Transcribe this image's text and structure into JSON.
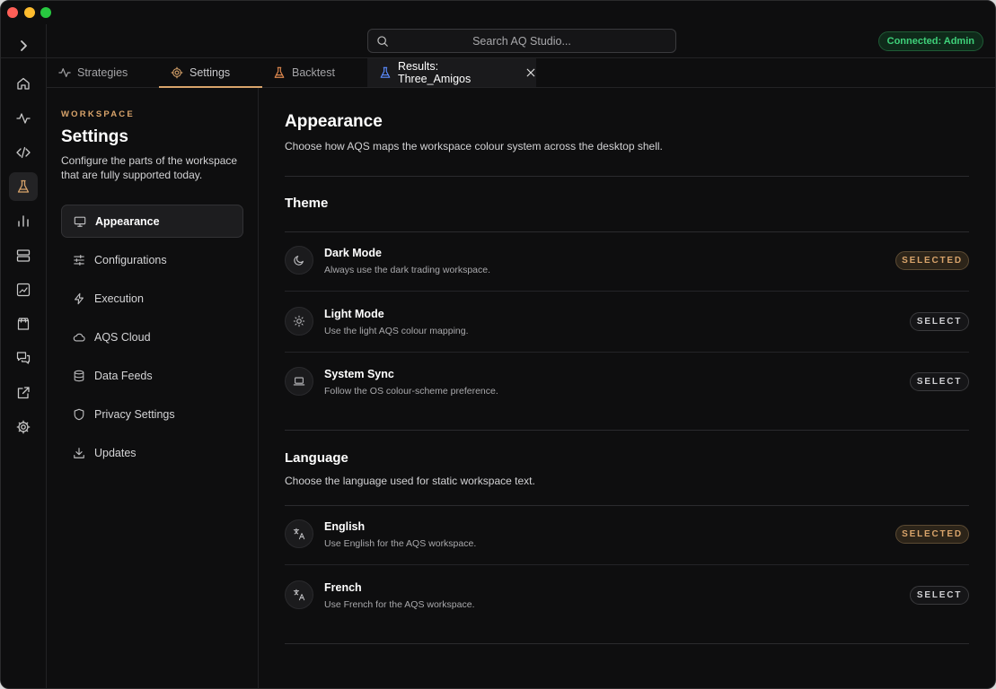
{
  "rail": {
    "toggle": "chevron-right-icon",
    "items": [
      "home-icon",
      "activity-icon",
      "code-icon",
      "flask-icon",
      "bar-chart-icon",
      "server-icon",
      "line-chart-icon",
      "shopping-bag-icon",
      "messages-icon",
      "external-link-icon",
      "gear-icon"
    ],
    "active_index": 3
  },
  "topbar": {
    "search_placeholder": "Search AQ Studio...",
    "connection_status": "Connected: Admin"
  },
  "tabs": [
    {
      "label": "Strategies",
      "icon": "activity-icon"
    },
    {
      "label": "Settings",
      "icon": "gear-icon",
      "active": true
    },
    {
      "label": "Backtest",
      "icon": "flask-icon"
    },
    {
      "label": "Results: Three_Amigos",
      "icon": "flask-icon",
      "closable": true
    }
  ],
  "sidebar": {
    "eyebrow": "WORKSPACE",
    "title": "Settings",
    "description": "Configure the parts of the workspace that are fully supported today.",
    "items": [
      {
        "label": "Appearance",
        "icon": "monitor-icon",
        "active": true
      },
      {
        "label": "Configurations",
        "icon": "sliders-icon"
      },
      {
        "label": "Execution",
        "icon": "bolt-icon"
      },
      {
        "label": "AQS Cloud",
        "icon": "cloud-icon"
      },
      {
        "label": "Data Feeds",
        "icon": "database-icon"
      },
      {
        "label": "Privacy Settings",
        "icon": "shield-icon"
      },
      {
        "label": "Updates",
        "icon": "download-icon"
      }
    ]
  },
  "main": {
    "title": "Appearance",
    "subtitle": "Choose how AQS maps the workspace colour system across the desktop shell.",
    "theme": {
      "heading": "Theme",
      "options": [
        {
          "title": "Dark Mode",
          "description": "Always use the dark trading workspace.",
          "icon": "moon-icon",
          "button": "SELECTED"
        },
        {
          "title": "Light Mode",
          "description": "Use the light AQS colour mapping.",
          "icon": "sun-icon",
          "button": "SELECT"
        },
        {
          "title": "System Sync",
          "description": "Follow the OS colour-scheme preference.",
          "icon": "laptop-icon",
          "button": "SELECT"
        }
      ]
    },
    "language": {
      "heading": "Language",
      "description": "Choose the language used for static workspace text.",
      "options": [
        {
          "title": "English",
          "description": "Use English for the AQS workspace.",
          "icon": "translate-icon",
          "button": "SELECTED"
        },
        {
          "title": "French",
          "description": "Use French for the AQS workspace.",
          "icon": "translate-icon",
          "button": "SELECT"
        }
      ]
    }
  },
  "colors": {
    "accent": "#d9a46b",
    "background": "#0e0e0f",
    "connected_green": "#3fd17a",
    "results_tab_icon": "#5b8cff"
  }
}
